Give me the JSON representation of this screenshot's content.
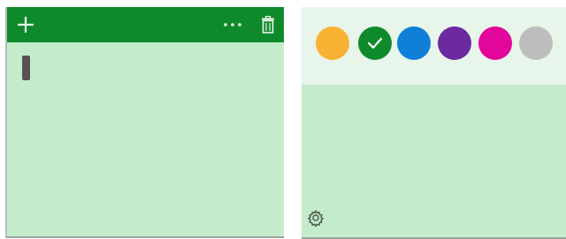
{
  "colors": {
    "note_background": "#c4eccb",
    "titlebar": "#0f8a2a",
    "palette_background": "#e8f5ea"
  },
  "left_note": {
    "toolbar_icons": [
      "add-icon",
      "more-icon",
      "delete-icon"
    ]
  },
  "right_note": {
    "palette": [
      {
        "name": "yellow",
        "color": "#f9b233",
        "selected": false
      },
      {
        "name": "green",
        "color": "#0f8a2a",
        "selected": true
      },
      {
        "name": "blue",
        "color": "#0f7fd8",
        "selected": false
      },
      {
        "name": "purple",
        "color": "#6b2aa0",
        "selected": false
      },
      {
        "name": "pink",
        "color": "#e3069a",
        "selected": false
      },
      {
        "name": "gray",
        "color": "#bdbdbd",
        "selected": false
      }
    ],
    "footer_icon": "gear-icon"
  }
}
